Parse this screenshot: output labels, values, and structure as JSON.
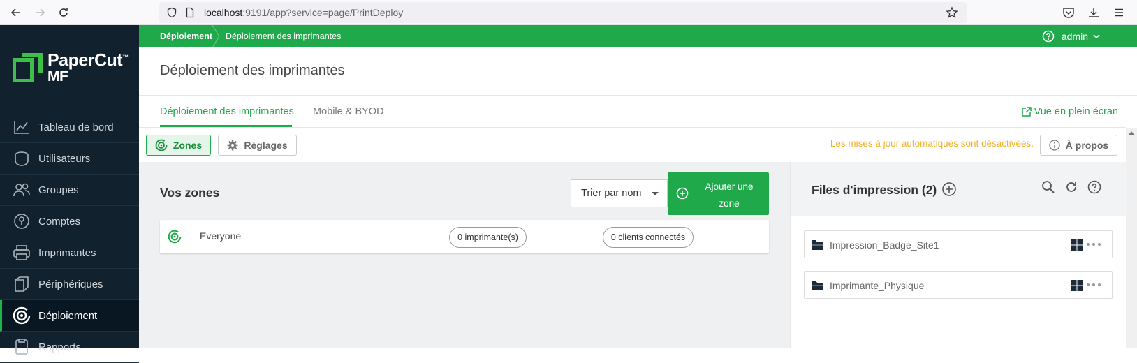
{
  "browser": {
    "url_host": "localhost",
    "url_rest": ":9191/app?service=page/PrintDeploy"
  },
  "brand": {
    "name_line1": "PaperCut",
    "name_line2": "MF",
    "trademark": "™",
    "accent_color": "#1fa94b"
  },
  "sidebar": {
    "items": [
      {
        "label": "Tableau de bord",
        "icon": "chart-line-icon"
      },
      {
        "label": "Utilisateurs",
        "icon": "user-icon"
      },
      {
        "label": "Groupes",
        "icon": "group-icon"
      },
      {
        "label": "Comptes",
        "icon": "account-icon"
      },
      {
        "label": "Imprimantes",
        "icon": "printer-icon"
      },
      {
        "label": "Périphériques",
        "icon": "device-icon"
      },
      {
        "label": "Déploiement",
        "icon": "deploy-icon",
        "active": true
      },
      {
        "label": "Rapports",
        "icon": "report-icon"
      }
    ]
  },
  "topbar": {
    "breadcrumb_root": "Déploiement",
    "breadcrumb_current": "Déploiement des imprimantes",
    "user": "admin"
  },
  "page": {
    "title": "Déploiement des imprimantes",
    "tabs": [
      {
        "label": "Déploiement des imprimantes",
        "active": true
      },
      {
        "label": "Mobile & BYOD",
        "active": false
      }
    ],
    "fullscreen_link": "Vue en plein écran"
  },
  "toolbar": {
    "zones_label": "Zones",
    "settings_label": "Réglages",
    "auto_update_notice": "Les mises à jour automatiques sont désactivées.",
    "about_label": "À propos"
  },
  "zones": {
    "title": "Vos zones",
    "sort_label": "Trier par nom",
    "add_line1": "Ajouter une",
    "add_line2": "zone",
    "rows": [
      {
        "name": "Everyone",
        "printers": "0 imprimante(s)",
        "clients": "0 clients connectés"
      }
    ]
  },
  "queues": {
    "title": "Files d'impression (2)",
    "items": [
      {
        "name": "Impression_Badge_Site1",
        "os": "windows-icon"
      },
      {
        "name": "Imprimante_Physique",
        "os": "windows-icon"
      }
    ]
  }
}
